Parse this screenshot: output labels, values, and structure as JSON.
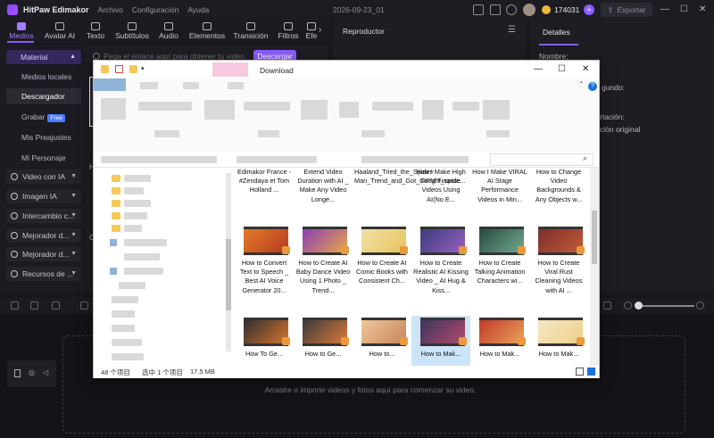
{
  "app": {
    "name": "HitPaw Edimakor",
    "menu": [
      "Archivo",
      "Configuración",
      "Ayuda"
    ],
    "project_name": "2026-09-23_01",
    "credits": "174031",
    "export_label": "Exportar"
  },
  "toolbar": {
    "tabs": [
      "Medios",
      "Avatar AI",
      "Texto",
      "Subtítulos",
      "Audio",
      "Elementos",
      "Transición",
      "Filtros",
      "Efe"
    ],
    "active": "Medios"
  },
  "sidebar": {
    "material_label": "Material",
    "sub_items": [
      "Medios locales",
      "Descargador",
      "Grabar",
      "Mis Preajustes",
      "Mi Personaje"
    ],
    "active_sub": "Descargador",
    "free_badge": "Free",
    "groups": [
      "Video con IA",
      "Imagen IA",
      "Intercambio c...",
      "Mejorador d...",
      "Mejorador d...",
      "Recursos de ..."
    ]
  },
  "media": {
    "link_placeholder": "Pega el enlace aquí para obtener tu video.",
    "download_button": "Descargar",
    "label_h": "H",
    "label_c": "C"
  },
  "player": {
    "title": "Reproductor"
  },
  "details": {
    "tab": "Detalles",
    "lines": [
      "Nombre:",
      "gundo:",
      "rtación:",
      "ción original"
    ]
  },
  "timeline": {
    "drop_text": "Arrastre o importe videos y fotos aquí para comenzar su video."
  },
  "explorer": {
    "title": "Download",
    "status_items": "48 个项目",
    "status_selected": "选中 1 个项目",
    "status_size": "17.5 MB",
    "files": [
      {
        "caption": "Edimakor France - #Zendaya et Tom Holland ...",
        "colors": [
          "#a14a8a",
          "#d68b45"
        ]
      },
      {
        "caption": "Extend Video Duration with AI _ Make Any Video Longe...",
        "colors": [
          "#6d2f86",
          "#c77a3b"
        ]
      },
      {
        "caption": "Haaland_Tried_the_Spider-Man_Trend_and_Got_Caught_spide...",
        "colors": [
          "#2f3a48",
          "#7a5c4a"
        ]
      },
      {
        "caption": "How I Make High RPM Finance Videos Using AI(No E...",
        "colors": [
          "#5a2f78",
          "#e05a9a"
        ]
      },
      {
        "caption": "How I Make VIRAL AI Stage Performance Videos in Min...",
        "colors": [
          "#5a2f78",
          "#cc5fb6"
        ]
      },
      {
        "caption": "How to Change Video Backgrounds & Any Objects w...",
        "colors": [
          "#4a2f84",
          "#b65fd6"
        ]
      },
      {
        "caption": "How to Convert Text to Speech _ Best AI Voice Generator 20...",
        "colors": [
          "#e07b2a",
          "#b83a1f"
        ]
      },
      {
        "caption": "How to Create AI Baby Dance Video Using 1 Photo _ Trend...",
        "colors": [
          "#8c3fb5",
          "#e7a64a"
        ]
      },
      {
        "caption": "How to Create AI Comic Books with Consistent Ch...",
        "colors": [
          "#f1e1a8",
          "#e8c35a"
        ]
      },
      {
        "caption": "How to Create Realistic AI Kissing Video _ AI Hug & Kiss...",
        "colors": [
          "#3a3c78",
          "#9a5fc2"
        ]
      },
      {
        "caption": "How to Create Talking Animation Characters wi...",
        "colors": [
          "#2a4a40",
          "#6fa98c"
        ]
      },
      {
        "caption": "How to Create Viral Rust Cleaning Videos with AI ...",
        "colors": [
          "#7a2f2a",
          "#c55a3a"
        ]
      },
      {
        "caption": "How To Ge...",
        "colors": [
          "#2f2f2f",
          "#d5742f"
        ]
      },
      {
        "caption": "How to Ge...",
        "colors": [
          "#3a3a3a",
          "#d9793a"
        ]
      },
      {
        "caption": "How to...",
        "colors": [
          "#f0c79a",
          "#c4865b"
        ]
      },
      {
        "caption": "How to Mak...",
        "colors": [
          "#3d3560",
          "#b04a6a"
        ]
      },
      {
        "caption": "How to Mak...",
        "colors": [
          "#c23a2a",
          "#e8a25a"
        ]
      },
      {
        "caption": "How to Mak...",
        "colors": [
          "#f6e7c3",
          "#efcf8a"
        ]
      }
    ],
    "selected_index": 15
  },
  "colors": {
    "accent": "#8a5cff",
    "bg": "#17171c"
  }
}
